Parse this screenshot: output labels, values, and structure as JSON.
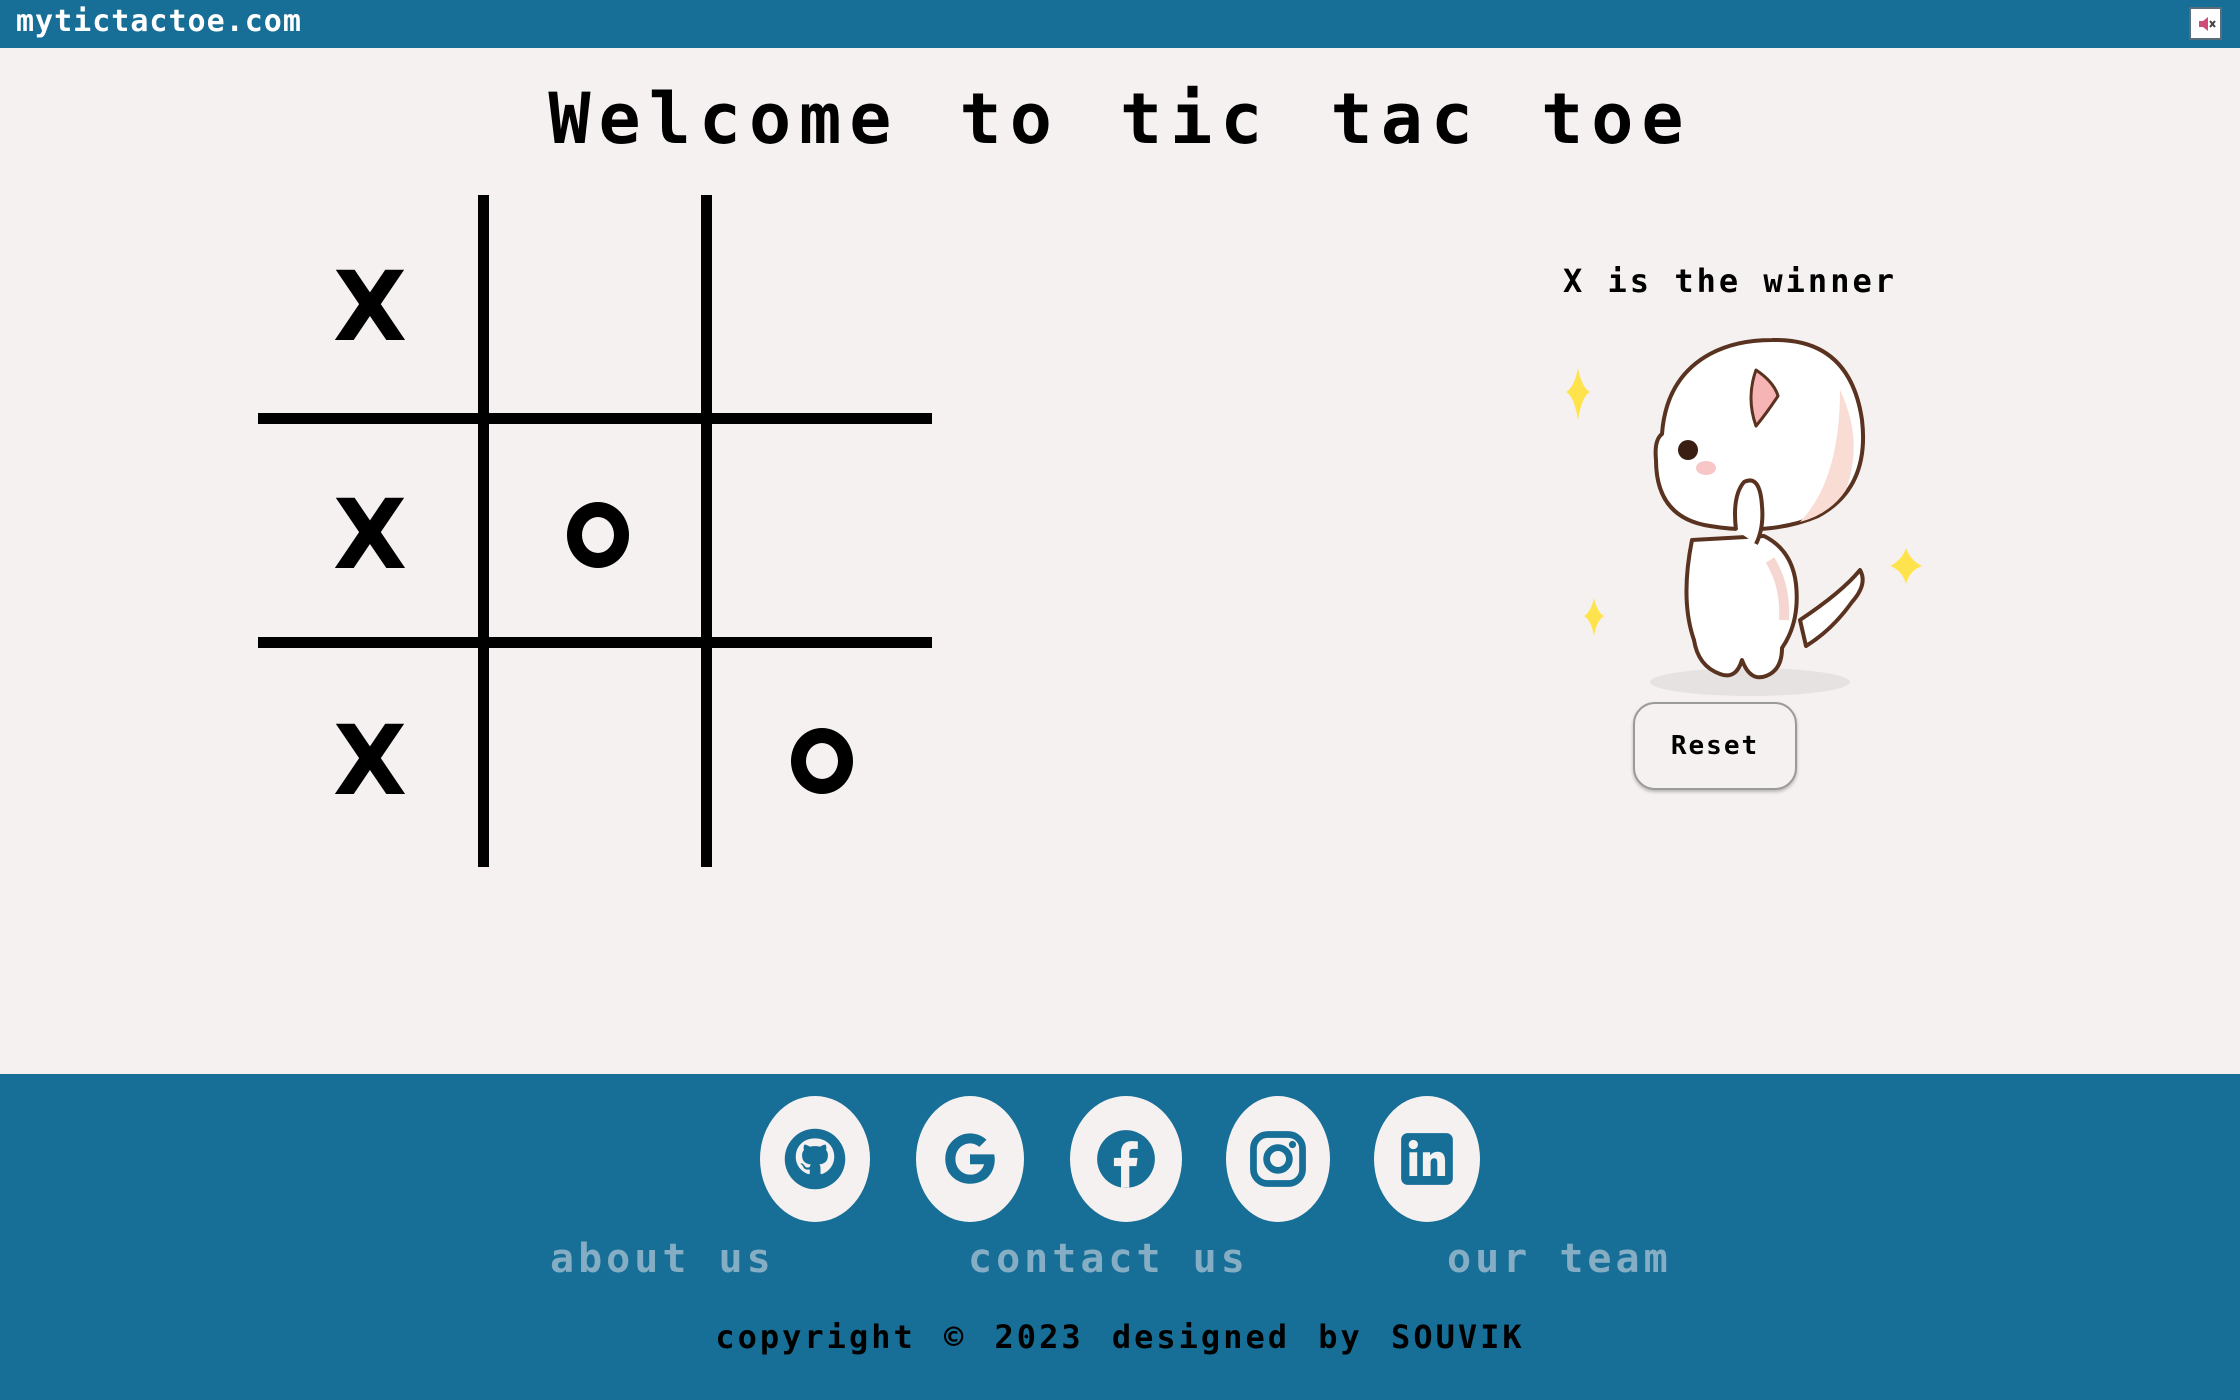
{
  "site": {
    "name": "mytictactoe.com"
  },
  "heading": "Welcome to tic tac toe",
  "board": {
    "cells": [
      "X",
      "",
      "",
      "X",
      "O",
      "",
      "X",
      "",
      "O"
    ]
  },
  "result": {
    "message": "X is the winner"
  },
  "controls": {
    "reset_label": "Reset"
  },
  "footer": {
    "social": [
      {
        "name": "github-icon"
      },
      {
        "name": "google-icon"
      },
      {
        "name": "facebook-icon"
      },
      {
        "name": "instagram-icon"
      },
      {
        "name": "linkedin-icon"
      }
    ],
    "links": [
      "about us",
      "contact us",
      "our team"
    ],
    "copyright": "copyright © 2023 designed by SOUVIK"
  },
  "colors": {
    "brand": "#176e96",
    "background": "#f5f1f0",
    "link": "#85aec5",
    "sparkle": "#ffe34d"
  }
}
